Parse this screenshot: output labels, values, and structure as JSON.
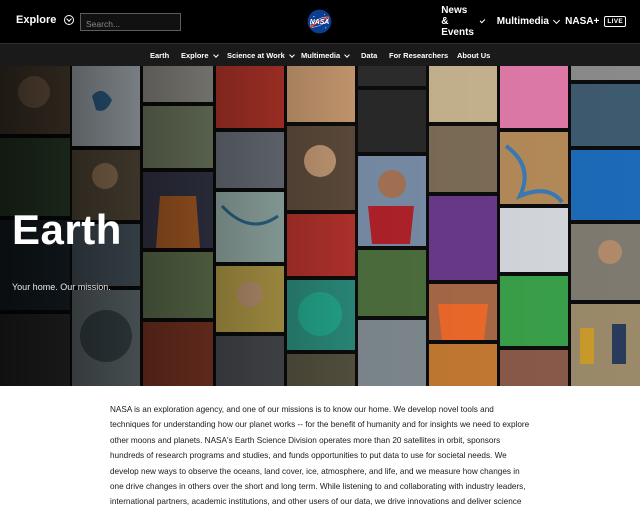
{
  "topbar": {
    "explore_label": "Explore",
    "search_placeholder": "Search...",
    "logo_alt": "NASA",
    "nav": [
      {
        "label": "News & Events"
      },
      {
        "label": "Multimedia"
      },
      {
        "label": "NASA+",
        "badge": "LIVE"
      }
    ]
  },
  "subnav": {
    "items": [
      {
        "label": "Earth",
        "has_menu": false
      },
      {
        "label": "Explore",
        "has_menu": true
      },
      {
        "label": "Science at Work",
        "has_menu": true
      },
      {
        "label": "Multimedia",
        "has_menu": true
      },
      {
        "label": "Data",
        "has_menu": false
      },
      {
        "label": "For Researchers",
        "has_menu": false
      },
      {
        "label": "About Us",
        "has_menu": false
      }
    ]
  },
  "hero": {
    "title": "Earth",
    "subtitle": "Your home. Our mission."
  },
  "intro": {
    "text": "NASA is an exploration agency, and one of our missions is to know our home. We develop novel tools and techniques for understanding how our planet works -- for the benefit of humanity and for insights we need to explore other moons and planets. NASA's Earth Science Division operates more than 20 satellites in orbit, sponsors hundreds of research programs and studies, and funds opportunities to put data to use for societal needs. We develop new ways to observe the oceans, land cover, ice, atmosphere, and life, and we measure how changes in one drive changes in others over the short and long term. While listening to and collaborating with industry leaders, international partners, academic institutions, and other users of our data, we drive innovations and deliver science to help inform decisions that benefit the nation and the world."
  },
  "colors": {
    "topbar_bg": "#000000",
    "subnav_bg": "#1a1a1a",
    "nasa_blue": "#0b3d91",
    "nasa_red": "#fc3d21"
  }
}
